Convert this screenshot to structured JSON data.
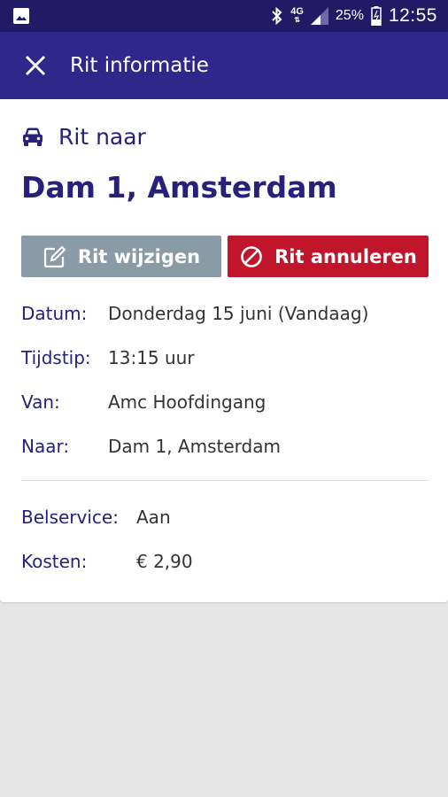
{
  "statusbar": {
    "network": "4G",
    "battery": "25%",
    "time": "12:55",
    "icons": [
      "image-icon",
      "bluetooth-icon",
      "signal-icon",
      "battery-icon"
    ]
  },
  "toolbar": {
    "title": "Rit informatie",
    "close_icon": "close-icon"
  },
  "ride": {
    "to_label": "Rit naar",
    "destination": "Dam 1, Amsterdam"
  },
  "actions": {
    "edit_label": "Rit wijzigen",
    "cancel_label": "Rit annuleren"
  },
  "details": {
    "date_label": "Datum:",
    "date_value": "Donderdag 15 juni (Vandaag)",
    "time_label": "Tijdstip:",
    "time_value": "13:15 uur",
    "from_label": "Van:",
    "from_value": "Amc Hoofdingang",
    "to_label": "Naar:",
    "to_value": "Dam 1, Amsterdam"
  },
  "extra": {
    "callservice_label": "Belservice:",
    "callservice_value": "Aan",
    "cost_label": "Kosten:",
    "cost_value": "€ 2,90"
  },
  "colors": {
    "statusbar": "#231a66",
    "toolbar": "#31268a",
    "primary_text": "#28207a",
    "edit_button": "#8a9ba8",
    "cancel_button": "#c0152b",
    "background": "#e5e5e5"
  }
}
